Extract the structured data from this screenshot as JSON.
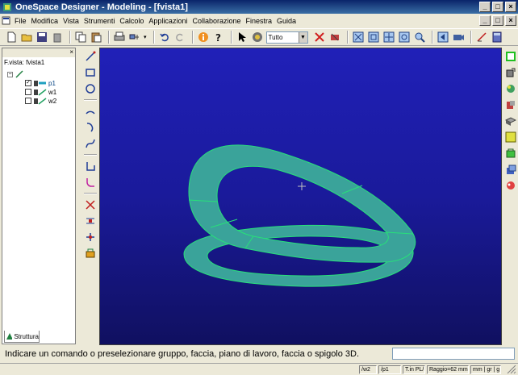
{
  "app": {
    "title": "OneSpace Designer - Modeling - [fvista1]",
    "icon": "app-icon"
  },
  "window_buttons": {
    "minimize": "_",
    "maximize": "□",
    "close": "×"
  },
  "menu": [
    "File",
    "Modifica",
    "Vista",
    "Strumenti",
    "Calcolo",
    "Applicazioni",
    "Collaborazione",
    "Finestra",
    "Guida"
  ],
  "toolbar": {
    "filter_combo": "Tutto"
  },
  "left_panel": {
    "close_label": "×",
    "title": "F.vista: fvista1",
    "tree": [
      {
        "label": "p1",
        "checked": "✓"
      },
      {
        "label": "w1",
        "checked": ""
      },
      {
        "label": "w2",
        "checked": ""
      }
    ],
    "tab_label": "Struttura"
  },
  "status": {
    "prompt": "Indicare un comando o preselezionare gruppo, faccia, piano di lavoro, faccia o spigolo 3D."
  },
  "bottom_bar": {
    "cells": [
      "/w2",
      "/p1",
      "T.in PL/P.ti",
      "Raggio=62 mm",
      "mm | gr | g"
    ]
  },
  "colors": {
    "viewport_top": "#2020b8",
    "viewport_bottom": "#101060",
    "ring_fill": "#3aa39a",
    "ring_edge": "#28e07a"
  }
}
